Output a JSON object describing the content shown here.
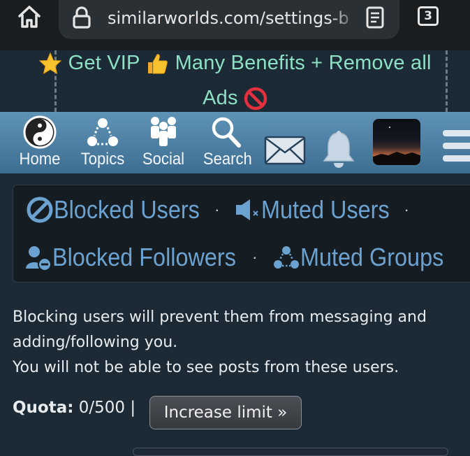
{
  "browser": {
    "url": "similarworlds.com/settings-b",
    "tab_count": "3"
  },
  "banner": {
    "line1": "Get VIP",
    "line1b": "Many Benefits + Remove all",
    "line2": "Ads"
  },
  "nav": {
    "home": "Home",
    "topics": "Topics",
    "social": "Social",
    "search": "Search"
  },
  "blocking": {
    "blocked_users": "Blocked Users",
    "muted_users": "Muted Users",
    "blocked_followers": "Blocked Followers",
    "muted_groups": "Muted Groups",
    "separator": "·"
  },
  "description": {
    "line1": "Blocking users will prevent them from messaging and",
    "line2": "adding/following you.",
    "line3": "You will not be able to see posts from these users."
  },
  "quota": {
    "label": "Quota:",
    "value": "0/500",
    "divider": "|",
    "button": "Increase limit »"
  }
}
